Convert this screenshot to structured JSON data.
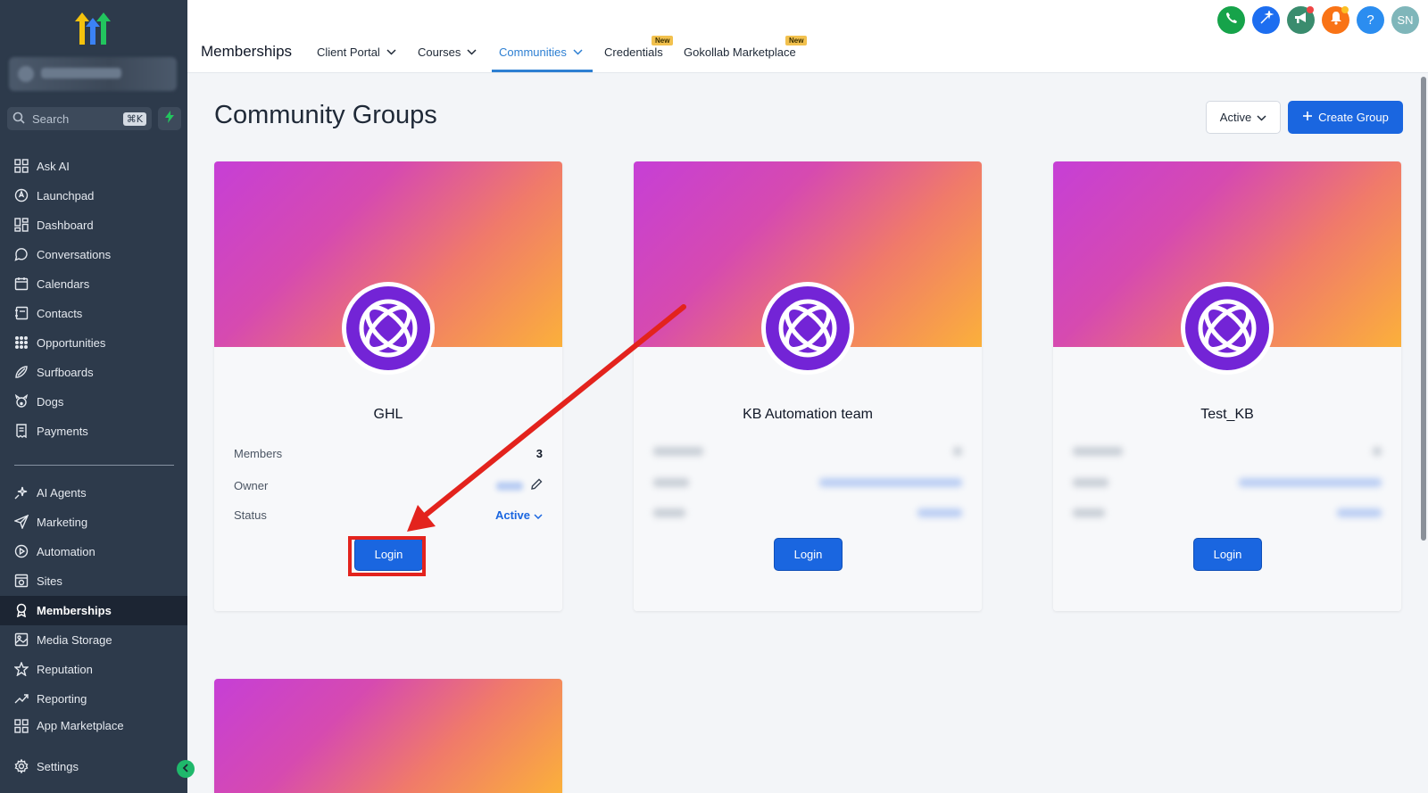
{
  "sidebar": {
    "search": {
      "placeholder": "Search",
      "shortcut": "⌘K"
    },
    "items": [
      {
        "label": "Ask AI",
        "icon": "grid-icon"
      },
      {
        "label": "Launchpad",
        "icon": "rocket-icon"
      },
      {
        "label": "Dashboard",
        "icon": "dashboard-icon"
      },
      {
        "label": "Conversations",
        "icon": "chat-icon"
      },
      {
        "label": "Calendars",
        "icon": "calendar-icon"
      },
      {
        "label": "Contacts",
        "icon": "contacts-icon"
      },
      {
        "label": "Opportunities",
        "icon": "opportunities-icon"
      },
      {
        "label": "Surfboards",
        "icon": "surfboard-icon"
      },
      {
        "label": "Dogs",
        "icon": "dog-icon"
      },
      {
        "label": "Payments",
        "icon": "receipt-icon"
      }
    ],
    "items2": [
      {
        "label": "AI Agents",
        "icon": "sparkle-icon"
      },
      {
        "label": "Marketing",
        "icon": "send-icon"
      },
      {
        "label": "Automation",
        "icon": "play-circle-icon"
      },
      {
        "label": "Sites",
        "icon": "sites-icon"
      },
      {
        "label": "Memberships",
        "icon": "badge-icon",
        "active": true
      },
      {
        "label": "Media Storage",
        "icon": "image-icon"
      },
      {
        "label": "Reputation",
        "icon": "star-icon"
      },
      {
        "label": "Reporting",
        "icon": "trend-icon"
      },
      {
        "label": "App Marketplace",
        "icon": "apps-icon"
      }
    ],
    "settings": "Settings"
  },
  "header": {
    "title": "Memberships",
    "tabs": [
      {
        "label": "Client Portal",
        "dropdown": true
      },
      {
        "label": "Courses",
        "dropdown": true
      },
      {
        "label": "Communities",
        "dropdown": true,
        "active": true
      },
      {
        "label": "Credentials",
        "badge": "New"
      },
      {
        "label": "Gokollab Marketplace",
        "badge": "New"
      }
    ],
    "avatar_initials": "SN",
    "help": "?"
  },
  "main": {
    "title": "Community Groups",
    "filter_label": "Active",
    "create_label": "Create Group",
    "cards": [
      {
        "name": "GHL",
        "members_label": "Members",
        "members_value": "3",
        "owner_label": "Owner",
        "status_label": "Status",
        "status_value": "Active",
        "login_label": "Login"
      },
      {
        "name": "KB Automation team",
        "login_label": "Login"
      },
      {
        "name": "Test_KB",
        "login_label": "Login"
      }
    ]
  },
  "colors": {
    "sidebar_bg": "#2d3a4b",
    "accent": "#1a66e0",
    "active_tab": "#2d7fd2",
    "annotation_red": "#e3231d"
  }
}
